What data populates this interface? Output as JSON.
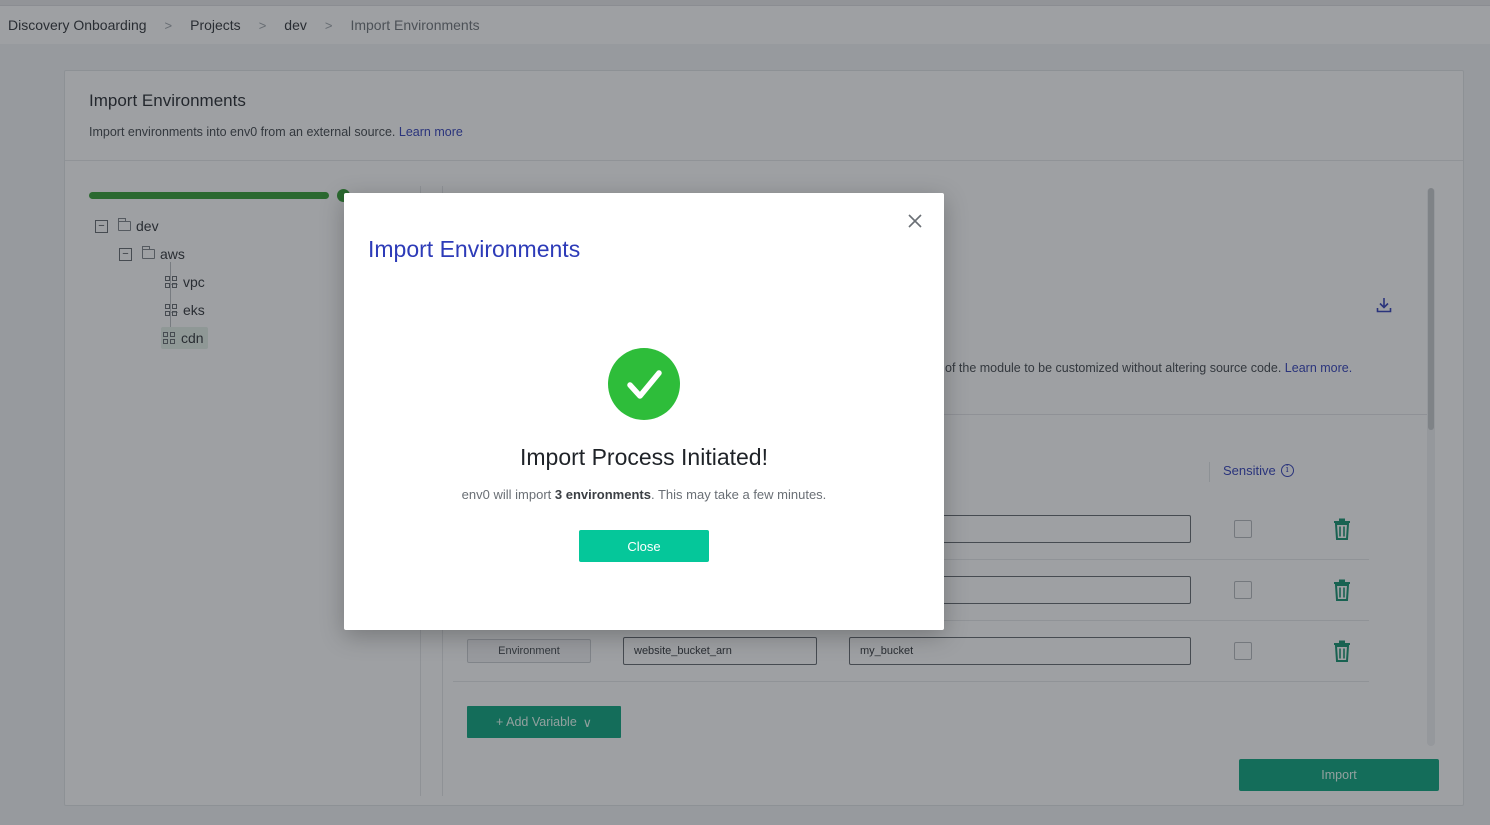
{
  "breadcrumb": {
    "items": [
      "Discovery Onboarding",
      "Projects",
      "dev",
      "Import Environments"
    ],
    "separator": ">"
  },
  "card": {
    "title": "Import Environments",
    "subtitle": "Import environments into env0 from an external source.",
    "learn_more": "Learn more"
  },
  "progress": {
    "fraction": 1.0
  },
  "tree": {
    "nodes": [
      {
        "label": "dev",
        "type": "folder",
        "toggle": "−"
      },
      {
        "label": "aws",
        "type": "folder",
        "toggle": "−"
      },
      {
        "label": "vpc",
        "type": "module"
      },
      {
        "label": "eks",
        "type": "module"
      },
      {
        "label": "cdn",
        "type": "module",
        "selected": true
      }
    ]
  },
  "variables": {
    "description": "of the module to be customized without altering source code.",
    "learn_more": "Learn more.",
    "sensitive_header": "Sensitive",
    "info_glyph": "i",
    "rows": [
      {
        "scope": "",
        "name": "",
        "value": ""
      },
      {
        "scope": "",
        "name": "",
        "value": ""
      },
      {
        "scope": "Environment",
        "name": "website_bucket_arn",
        "value": "my_bucket"
      }
    ],
    "add_variable_label": "+ Add Variable",
    "add_variable_chevron": "∨"
  },
  "import_button": "Import",
  "modal": {
    "title": "Import Environments",
    "heading": "Import Process Initiated!",
    "text_prefix": "env0 will import ",
    "text_bold": "3 environments",
    "text_suffix": ". This may take a few minutes.",
    "close_button": "Close"
  },
  "colors": {
    "accent_blue": "#2d3bb8",
    "success_green": "#2ebd3a",
    "primary_button": "#05c79a",
    "secondary_button": "#05a37a",
    "progress_green": "#2e9b2e"
  },
  "icons": [
    "chevron-right-icon",
    "folder-icon",
    "module-icon",
    "download-icon",
    "info-icon",
    "trash-icon",
    "close-icon",
    "check-circle-icon"
  ]
}
